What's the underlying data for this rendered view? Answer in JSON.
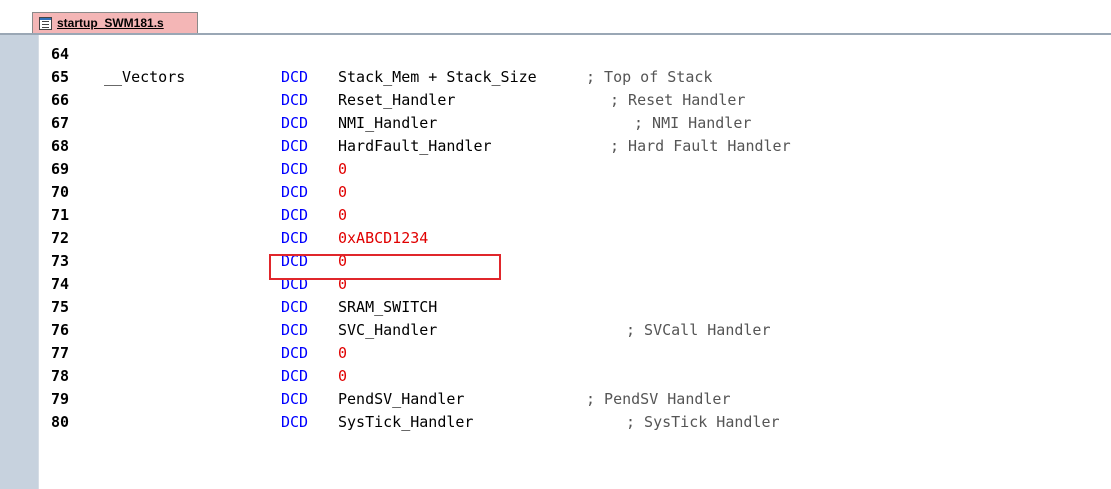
{
  "tab": {
    "filename": "startup_SWM181.s"
  },
  "colors": {
    "keyword": "#0000ff",
    "number": "#e00000",
    "highlight_box": "#e0262b",
    "tab_active": "#f4b6b6"
  },
  "lines": [
    {
      "ln": "64",
      "label": "",
      "kw": "",
      "operand": "",
      "operand_type": "ident",
      "comment": ""
    },
    {
      "ln": "65",
      "label": "__Vectors",
      "kw": "DCD",
      "operand": "Stack_Mem + Stack_Size",
      "operand_type": "ident",
      "comment": "; Top of Stack"
    },
    {
      "ln": "66",
      "label": "",
      "kw": "DCD",
      "operand": "Reset_Handler",
      "operand_type": "ident",
      "comment": "; Reset Handler"
    },
    {
      "ln": "67",
      "label": "",
      "kw": "DCD",
      "operand": "NMI_Handler",
      "operand_type": "ident",
      "comment": "; NMI Handler"
    },
    {
      "ln": "68",
      "label": "",
      "kw": "DCD",
      "operand": "HardFault_Handler",
      "operand_type": "ident",
      "comment": "; Hard Fault Handler"
    },
    {
      "ln": "69",
      "label": "",
      "kw": "DCD",
      "operand": "0",
      "operand_type": "number",
      "comment": ""
    },
    {
      "ln": "70",
      "label": "",
      "kw": "DCD",
      "operand": "0",
      "operand_type": "number",
      "comment": ""
    },
    {
      "ln": "71",
      "label": "",
      "kw": "DCD",
      "operand": "0",
      "operand_type": "number",
      "comment": ""
    },
    {
      "ln": "72",
      "label": "",
      "kw": "DCD",
      "operand": "0xABCD1234",
      "operand_type": "number",
      "comment": ""
    },
    {
      "ln": "73",
      "label": "",
      "kw": "DCD",
      "operand": "0",
      "operand_type": "number",
      "comment": ""
    },
    {
      "ln": "74",
      "label": "",
      "kw": "DCD",
      "operand": "0",
      "operand_type": "number",
      "comment": ""
    },
    {
      "ln": "75",
      "label": "",
      "kw": "DCD",
      "operand": "SRAM_SWITCH",
      "operand_type": "ident",
      "comment": ""
    },
    {
      "ln": "76",
      "label": "",
      "kw": "DCD",
      "operand": "SVC_Handler",
      "operand_type": "ident",
      "comment": "; SVCall Handler"
    },
    {
      "ln": "77",
      "label": "",
      "kw": "DCD",
      "operand": "0",
      "operand_type": "number",
      "comment": ""
    },
    {
      "ln": "78",
      "label": "",
      "kw": "DCD",
      "operand": "0",
      "operand_type": "number",
      "comment": ""
    },
    {
      "ln": "79",
      "label": "",
      "kw": "DCD",
      "operand": "PendSV_Handler",
      "operand_type": "ident",
      "comment": "; PendSV Handler"
    },
    {
      "ln": "80",
      "label": "",
      "kw": "DCD",
      "operand": "SysTick_Handler",
      "operand_type": "ident",
      "comment": "; SysTick Handler"
    }
  ]
}
